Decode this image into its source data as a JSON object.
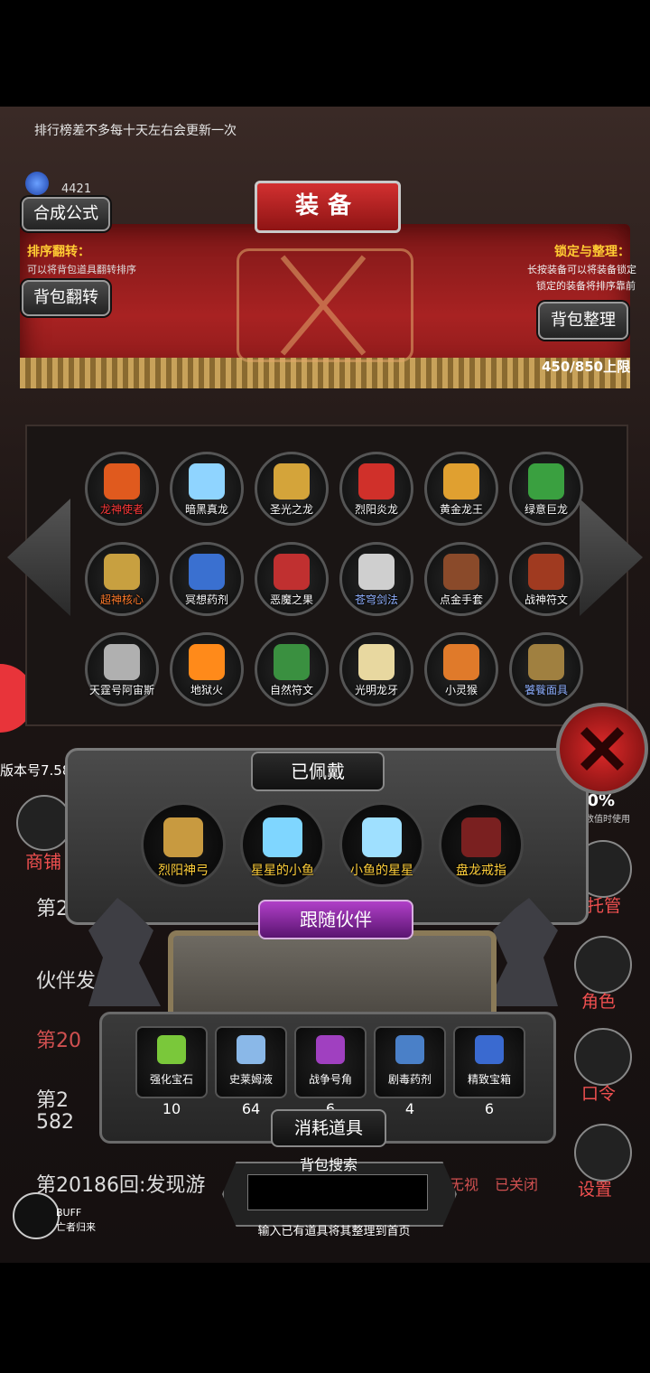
{
  "notice": "排行榜差不多每十天左右会更新一次",
  "currency": {
    "value": "4421",
    "icon": "blue-gem-icon"
  },
  "title": "装备",
  "compose_button": "合成公式",
  "sort_flip": {
    "title": "排序翻转：",
    "desc": "可以将背包道具翻转排序",
    "button": "背包翻转"
  },
  "lock_sort": {
    "title": "锁定与整理：",
    "desc1": "长按装备可以将装备锁定",
    "desc2": "锁定的装备将排序靠前",
    "button": "背包整理"
  },
  "capacity": "450/850上限",
  "grid_items": [
    {
      "name": "龙神使者",
      "color": "#e05a1e",
      "name_color": "#ff3a3a"
    },
    {
      "name": "暗黑真龙",
      "color": "#8fd4ff"
    },
    {
      "name": "圣光之龙",
      "color": "#d4a43a"
    },
    {
      "name": "烈阳炎龙",
      "color": "#d0302a"
    },
    {
      "name": "黄金龙王",
      "color": "#e0a030"
    },
    {
      "name": "绿意巨龙",
      "color": "#3aa040"
    },
    {
      "name": "超神核心",
      "color": "#c8a040",
      "name_color": "#ff7a2a"
    },
    {
      "name": "冥想药剂",
      "color": "#3a70d0"
    },
    {
      "name": "恶魔之果",
      "color": "#c03030"
    },
    {
      "name": "苍穹剑法",
      "color": "#cfcfcf",
      "name_color": "#8fb0ff"
    },
    {
      "name": "点金手套",
      "color": "#8a4a2a"
    },
    {
      "name": "战神符文",
      "color": "#a03a20"
    },
    {
      "name": "天霆号阿宙斯",
      "color": "#b0b0b0"
    },
    {
      "name": "地狱火",
      "color": "#ff8a1a"
    },
    {
      "name": "自然符文",
      "color": "#3a9040"
    },
    {
      "name": "光明龙牙",
      "color": "#e8d8a0"
    },
    {
      "name": "小灵猴",
      "color": "#e07a2a"
    },
    {
      "name": "饕餮面具",
      "color": "#a08040",
      "name_color": "#8fb0ff"
    }
  ],
  "equipped_title": "已佩戴",
  "equipped": [
    {
      "name": "烈阳神弓",
      "color": "#c89a40"
    },
    {
      "name": "星星的小鱼",
      "color": "#7fd6ff"
    },
    {
      "name": "小鱼的星星",
      "color": "#9fe0ff"
    },
    {
      "name": "盘龙戒指",
      "color": "#7a2020"
    }
  ],
  "follow_title": "跟随伙伴",
  "consumables_title": "消耗道具",
  "consumables": [
    {
      "name": "强化宝石",
      "count": "10",
      "color": "#7ac83a"
    },
    {
      "name": "史莱姆液",
      "count": "64",
      "color": "#8ab8e8"
    },
    {
      "name": "战争号角",
      "count": "6",
      "color": "#a040c0"
    },
    {
      "name": "剧毒药剂",
      "count": "4",
      "color": "#4a80c8"
    },
    {
      "name": "精致宝箱",
      "count": "6",
      "color": "#3a6ad0"
    }
  ],
  "search": {
    "label": "背包搜索",
    "placeholder": "",
    "hint": "输入已有道具将其整理到首页"
  },
  "version": "版本号7.58",
  "shop_label": "商铺",
  "bg_lines": [
    "第2",
    "伙伴发",
    "第20",
    "第2",
    "582",
    "第20186回:发现游"
  ],
  "right_labels": {
    "stats": "50%",
    "stats_note": "其数值时使用",
    "manage": "托管",
    "role": "角色",
    "order": "口令",
    "settings": "设置",
    "watch": "无视",
    "closed": "已关闭"
  },
  "buff": {
    "label": "BUFF",
    "sub": "亡者归来"
  }
}
